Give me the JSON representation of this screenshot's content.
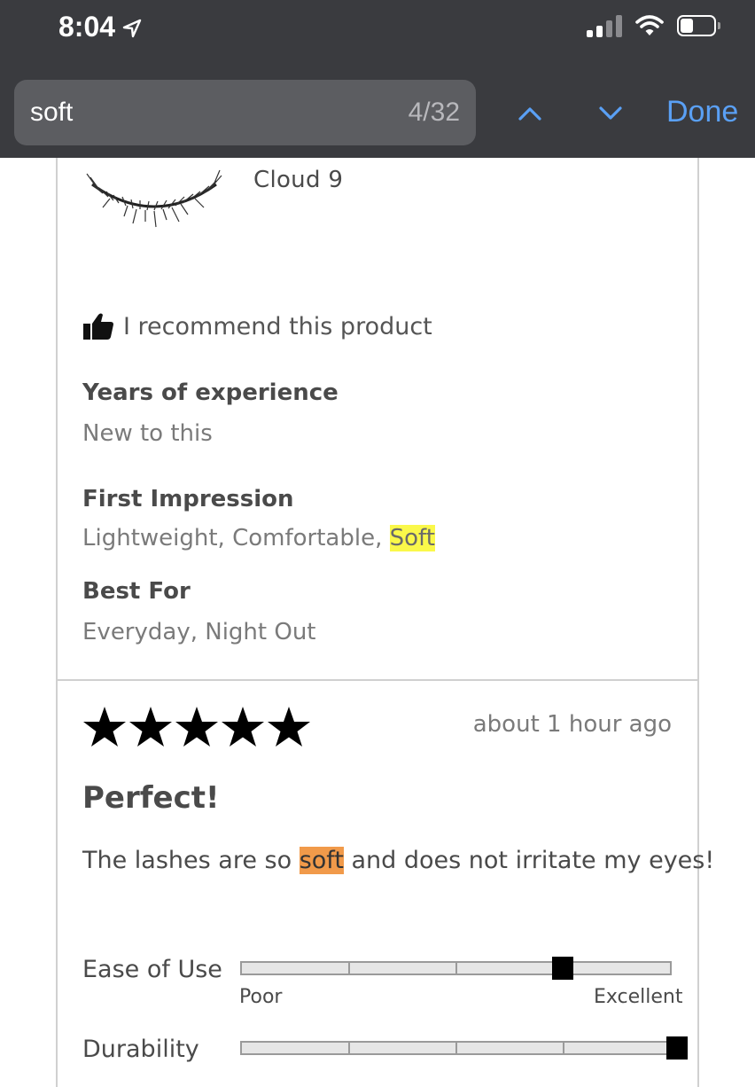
{
  "status_bar": {
    "time": "8:04",
    "icons": [
      "location-arrow-icon",
      "cellular-signal-icon",
      "wifi-icon",
      "battery-icon"
    ]
  },
  "find_bar": {
    "query": "soft",
    "match_count": "4/32",
    "done_label": "Done",
    "icons": [
      "chevron-up-icon",
      "chevron-down-icon"
    ]
  },
  "product": {
    "name": "Cloud 9",
    "image": "eyelash-image"
  },
  "recommend": {
    "icon": "thumbs-up-icon",
    "text": "I recommend this product"
  },
  "details": {
    "years_label": "Years of experience",
    "years_value": "New to this",
    "impression_label": "First Impression",
    "impression_value_prefix": "Lightweight, Comfortable, ",
    "impression_value_match": "Soft",
    "best_for_label": "Best For",
    "best_for_value": "Everyday, Night Out"
  },
  "review": {
    "stars": 5,
    "time_ago": "about 1 hour ago",
    "title": "Perfect!",
    "body_prefix": "The lashes are so ",
    "body_match": "soft",
    "body_suffix": " and does not irritate my eyes!"
  },
  "ratings": [
    {
      "label": "Ease of Use",
      "min_label": "Poor",
      "max_label": "Excellent",
      "value_fraction": 0.75
    },
    {
      "label": "Durability",
      "value_fraction": 1.0
    }
  ],
  "colors": {
    "chrome_bg": "#3a3b3f",
    "search_bg": "#5c5d61",
    "accent_blue": "#5aa0f5",
    "current_match": "#f19a4a",
    "other_match": "#faf84a"
  }
}
